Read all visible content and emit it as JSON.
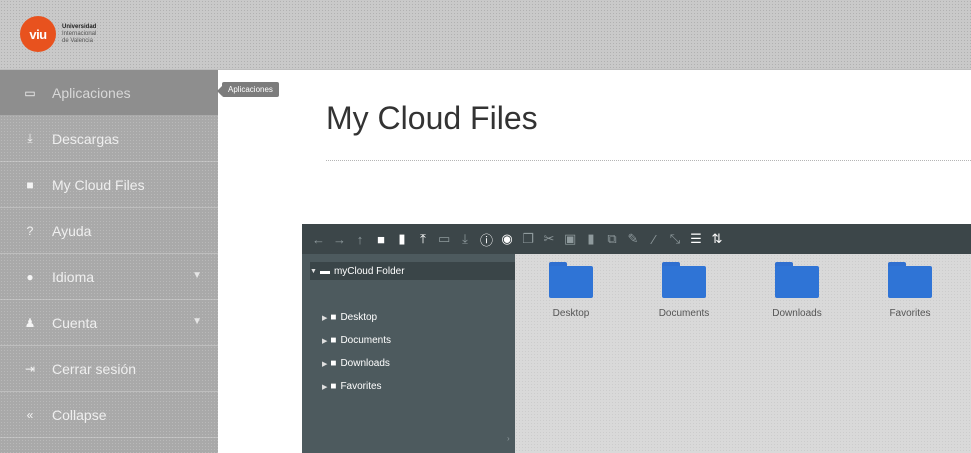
{
  "header": {
    "logo_mark": "viu",
    "logo_lines": [
      "Universidad",
      "Internacional",
      "de Valencia"
    ]
  },
  "sidebar": {
    "items": [
      {
        "label": "Aplicaciones",
        "icon": "window-icon"
      },
      {
        "label": "Descargas",
        "icon": "download-icon"
      },
      {
        "label": "My Cloud Files",
        "icon": "folder-icon"
      },
      {
        "label": "Ayuda",
        "icon": "question-icon"
      },
      {
        "label": "Idioma",
        "icon": "globe-icon"
      },
      {
        "label": "Cuenta",
        "icon": "user-icon"
      },
      {
        "label": "Cerrar sesión",
        "icon": "sign-out-icon"
      },
      {
        "label": "Collapse",
        "icon": "collapse-icon"
      }
    ],
    "tooltip": "Aplicaciones"
  },
  "main": {
    "title": "My Cloud Files"
  },
  "file_manager": {
    "tree": {
      "root": "myCloud Folder",
      "children": [
        "Desktop",
        "Documents",
        "Downloads",
        "Favorites"
      ]
    },
    "files": [
      "Desktop",
      "Documents",
      "Downloads",
      "Favorites"
    ]
  }
}
